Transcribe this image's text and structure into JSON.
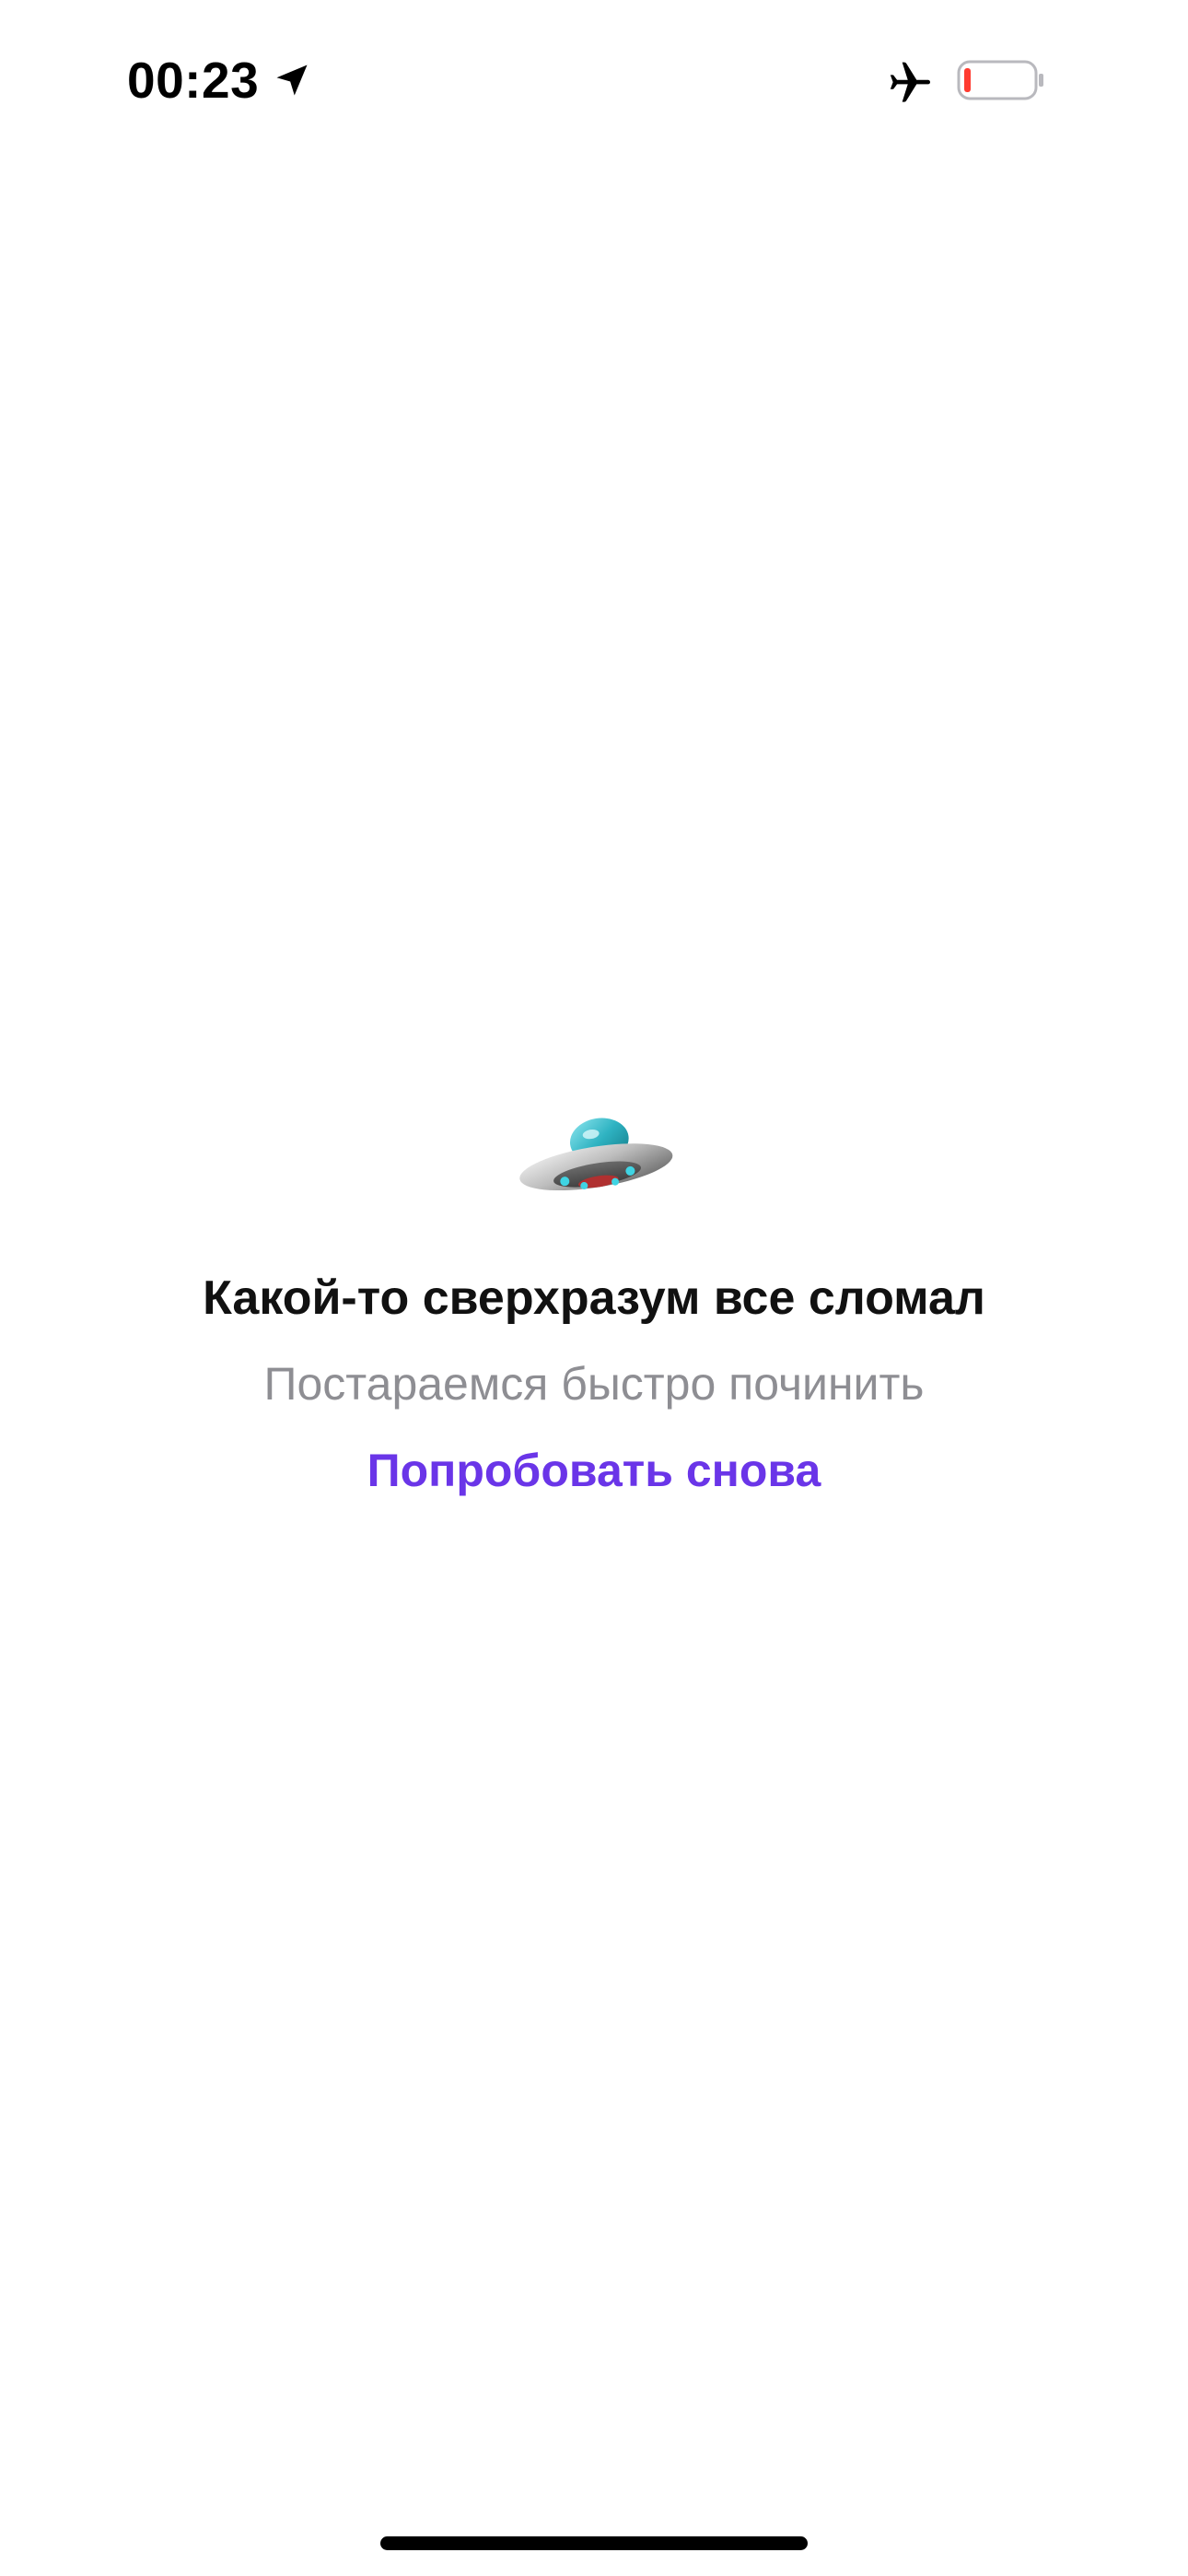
{
  "status_bar": {
    "time": "00:23",
    "icons": [
      "location-arrow-icon",
      "airplane-icon",
      "battery-icon"
    ],
    "battery_level": 0.1,
    "battery_color": "#ff3b30"
  },
  "error": {
    "icon": "ufo-icon",
    "title": "Какой-то сверхразум все сломал",
    "subtitle": "Постараемся быстро починить",
    "retry_label": "Попробовать снова"
  },
  "colors": {
    "accent": "#6a35e8",
    "subtitle": "#8e8e93",
    "background": "#ffffff"
  }
}
